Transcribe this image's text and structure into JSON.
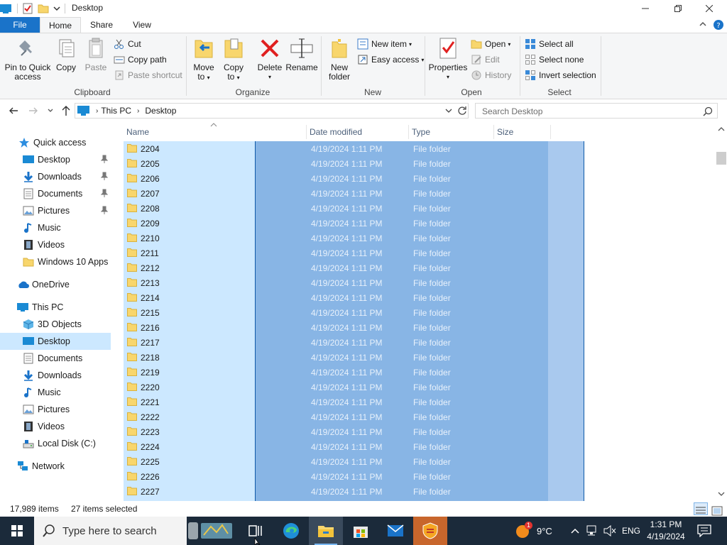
{
  "window": {
    "title": "Desktop",
    "min_icon": "minimize-icon",
    "max_icon": "maximize-icon",
    "close_icon": "close-icon"
  },
  "tabs": {
    "file": "File",
    "home": "Home",
    "share": "Share",
    "view": "View"
  },
  "ribbon": {
    "clipboard": {
      "label": "Clipboard",
      "pin": "Pin to Quick access",
      "pin_line1": "Pin to Quick",
      "pin_line2": "access",
      "copy": "Copy",
      "paste": "Paste",
      "cut": "Cut",
      "copy_path": "Copy path",
      "paste_shortcut": "Paste shortcut"
    },
    "organize": {
      "label": "Organize",
      "move_to_1": "Move",
      "move_to_2": "to",
      "copy_to_1": "Copy",
      "copy_to_2": "to",
      "delete": "Delete",
      "rename": "Rename"
    },
    "new": {
      "label": "New",
      "new_folder_1": "New",
      "new_folder_2": "folder",
      "new_item": "New item",
      "easy_access": "Easy access"
    },
    "open": {
      "label": "Open",
      "properties": "Properties",
      "open": "Open",
      "edit": "Edit",
      "history": "History"
    },
    "select": {
      "label": "Select",
      "select_all": "Select all",
      "select_none": "Select none",
      "invert": "Invert selection"
    }
  },
  "address": {
    "crumbs": [
      "This PC",
      "Desktop"
    ],
    "search_placeholder": "Search Desktop"
  },
  "nav": {
    "quick_access": "Quick access",
    "quick_items": [
      "Desktop",
      "Downloads",
      "Documents",
      "Pictures",
      "Music",
      "Videos",
      "Windows 10 Apps"
    ],
    "onedrive": "OneDrive",
    "this_pc": "This PC",
    "pc_items": [
      "3D Objects",
      "Desktop",
      "Documents",
      "Downloads",
      "Music",
      "Pictures",
      "Videos",
      "Local Disk (C:)"
    ],
    "network": "Network"
  },
  "columns": {
    "name": "Name",
    "date": "Date modified",
    "type": "Type",
    "size": "Size"
  },
  "rows": [
    {
      "name": "2204",
      "date": "4/19/2024 1:11 PM",
      "type": "File folder"
    },
    {
      "name": "2205",
      "date": "4/19/2024 1:11 PM",
      "type": "File folder"
    },
    {
      "name": "2206",
      "date": "4/19/2024 1:11 PM",
      "type": "File folder"
    },
    {
      "name": "2207",
      "date": "4/19/2024 1:11 PM",
      "type": "File folder"
    },
    {
      "name": "2208",
      "date": "4/19/2024 1:11 PM",
      "type": "File folder"
    },
    {
      "name": "2209",
      "date": "4/19/2024 1:11 PM",
      "type": "File folder"
    },
    {
      "name": "2210",
      "date": "4/19/2024 1:11 PM",
      "type": "File folder"
    },
    {
      "name": "2211",
      "date": "4/19/2024 1:11 PM",
      "type": "File folder"
    },
    {
      "name": "2212",
      "date": "4/19/2024 1:11 PM",
      "type": "File folder"
    },
    {
      "name": "2213",
      "date": "4/19/2024 1:11 PM",
      "type": "File folder"
    },
    {
      "name": "2214",
      "date": "4/19/2024 1:11 PM",
      "type": "File folder"
    },
    {
      "name": "2215",
      "date": "4/19/2024 1:11 PM",
      "type": "File folder"
    },
    {
      "name": "2216",
      "date": "4/19/2024 1:11 PM",
      "type": "File folder"
    },
    {
      "name": "2217",
      "date": "4/19/2024 1:11 PM",
      "type": "File folder"
    },
    {
      "name": "2218",
      "date": "4/19/2024 1:11 PM",
      "type": "File folder"
    },
    {
      "name": "2219",
      "date": "4/19/2024 1:11 PM",
      "type": "File folder"
    },
    {
      "name": "2220",
      "date": "4/19/2024 1:11 PM",
      "type": "File folder"
    },
    {
      "name": "2221",
      "date": "4/19/2024 1:11 PM",
      "type": "File folder"
    },
    {
      "name": "2222",
      "date": "4/19/2024 1:11 PM",
      "type": "File folder"
    },
    {
      "name": "2223",
      "date": "4/19/2024 1:11 PM",
      "type": "File folder"
    },
    {
      "name": "2224",
      "date": "4/19/2024 1:11 PM",
      "type": "File folder"
    },
    {
      "name": "2225",
      "date": "4/19/2024 1:11 PM",
      "type": "File folder"
    },
    {
      "name": "2226",
      "date": "4/19/2024 1:11 PM",
      "type": "File folder"
    },
    {
      "name": "2227",
      "date": "4/19/2024 1:11 PM",
      "type": "File folder"
    }
  ],
  "status": {
    "items": "17,989 items",
    "selected": "27 items selected"
  },
  "taskbar": {
    "search_placeholder": "Type here to search",
    "weather": "9°C",
    "weather_badge": "1",
    "lang": "ENG",
    "time": "1:31 PM",
    "date": "4/19/2024"
  },
  "colors": {
    "accent": "#1a73c9",
    "selection_light": "#cce8ff",
    "selection_dark": "#88b5e5",
    "taskbar": "#1b2a3a"
  }
}
